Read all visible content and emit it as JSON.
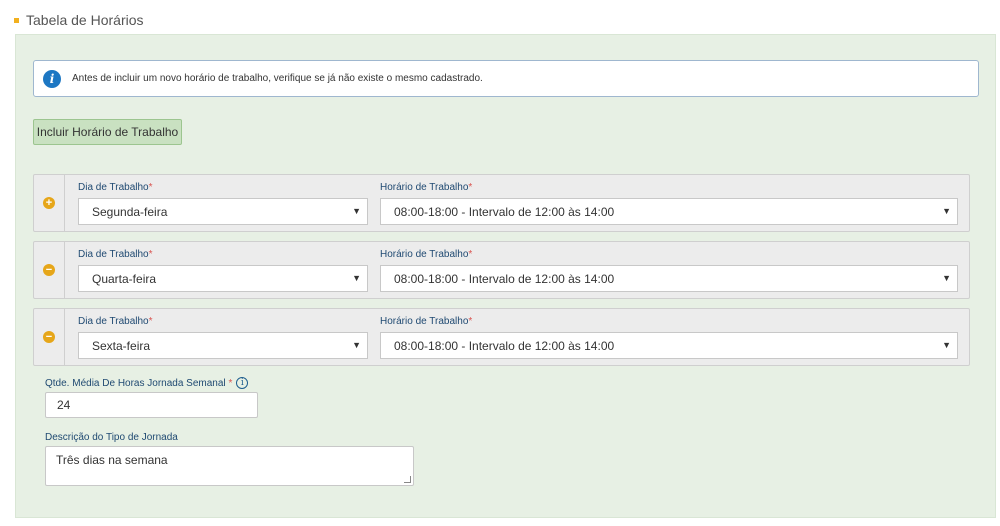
{
  "section": {
    "title": "Tabela de Horários"
  },
  "info": {
    "text": "Antes de incluir um novo horário de trabalho, verifique se já não existe o mesmo cadastrado."
  },
  "add_button": {
    "label": "Incluir Horário de Trabalho"
  },
  "rows": [
    {
      "icon": "plus-icon",
      "day_label": "Dia de Trabalho",
      "hour_label": "Horário de Trabalho",
      "day_value": "Segunda-feira",
      "hour_value": "08:00-18:00 - Intervalo de 12:00 às 14:00"
    },
    {
      "icon": "minus-icon",
      "day_label": "Dia de Trabalho",
      "hour_label": "Horário de Trabalho",
      "day_value": "Quarta-feira",
      "hour_value": "08:00-18:00 - Intervalo de 12:00 às 14:00"
    },
    {
      "icon": "minus-icon",
      "day_label": "Dia de Trabalho",
      "hour_label": "Horário de Trabalho",
      "day_value": "Sexta-feira",
      "hour_value": "08:00-18:00 - Intervalo de 12:00 às 14:00"
    }
  ],
  "required_mark": "*",
  "qtd": {
    "label": "Qtde. Média De Horas Jornada Semanal",
    "value": "24"
  },
  "descricao": {
    "label": "Descrição do Tipo de Jornada",
    "value": "Três dias na semana"
  },
  "colors": {
    "accent": "#e6a619",
    "panel": "#e7f0e4",
    "info_icon": "#1d77c3"
  }
}
